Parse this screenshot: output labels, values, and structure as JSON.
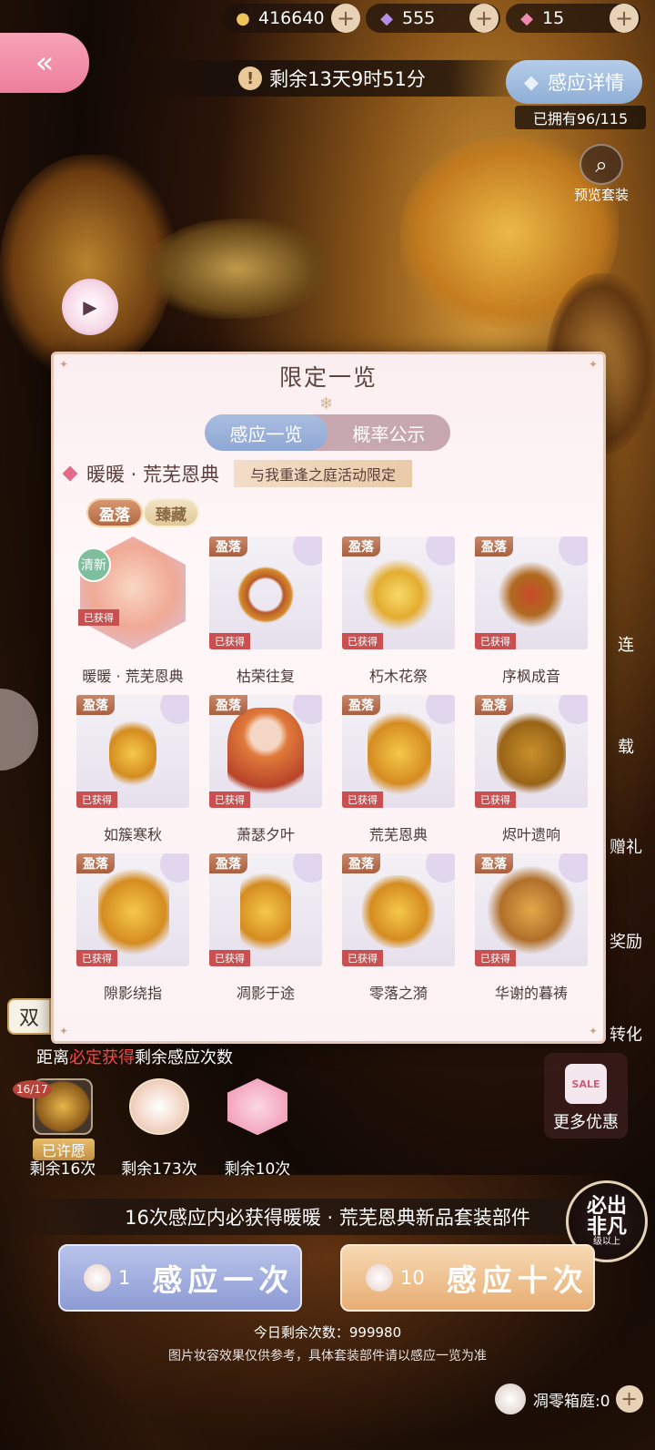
{
  "resources": [
    {
      "icon": "cat-coin-icon",
      "value": "416640"
    },
    {
      "icon": "purple-diamond-icon",
      "value": "555"
    },
    {
      "icon": "pink-diamond-icon",
      "value": "15"
    }
  ],
  "timer": {
    "text": "剩余13天9时51分"
  },
  "detail_button": "感应详情",
  "owned": "已拥有96/115",
  "preview_label": "预览套装",
  "modal": {
    "title": "限定一览",
    "tabs": [
      "感应一览",
      "概率公示"
    ],
    "suit_name": "暖暖 · 荒芜恩典",
    "ribbon": "与我重逢之庭活动限定",
    "badges": [
      "盈落",
      "臻藏"
    ],
    "new_badge": "清新",
    "tag": "盈落",
    "obtained": "已获得",
    "items": [
      "暖暖 · 荒芜恩典",
      "枯荣往复",
      "朽木花祭",
      "序枫成音",
      "如簇寒秋",
      "萧瑟夕叶",
      "荒芜恩典",
      "烬叶遗响",
      "隙影绕指",
      "凋影于途",
      "零落之漪",
      "华谢的暮祷"
    ]
  },
  "side_labels": [
    "连",
    "载",
    "赠礼",
    "奖励",
    "转化"
  ],
  "more_deals": "更多优惠",
  "sale_tag": "SALE",
  "shuang": "双",
  "distance": {
    "prefix": "距离",
    "red": "必定获得",
    "suffix": "剩余感应次数"
  },
  "pity": {
    "count": "16/17",
    "wished": "已许愿",
    "rows": [
      "剩余16次",
      "剩余173次",
      "剩余10次"
    ]
  },
  "guarantee": "16次感应内必获得暖暖 · 荒芜恩典新品套装部件",
  "seal": {
    "line1": "必出",
    "line2": "非凡",
    "small": "级以上"
  },
  "draw_one": {
    "count": "1",
    "label": "感应一次"
  },
  "draw_ten": {
    "count": "10",
    "label": "感应十次"
  },
  "today": "今日剩余次数：999980",
  "disclaimer": "图片妆容效果仅供参考，具体套装部件请以感应一览为准",
  "box": "凋零箱庭:0"
}
